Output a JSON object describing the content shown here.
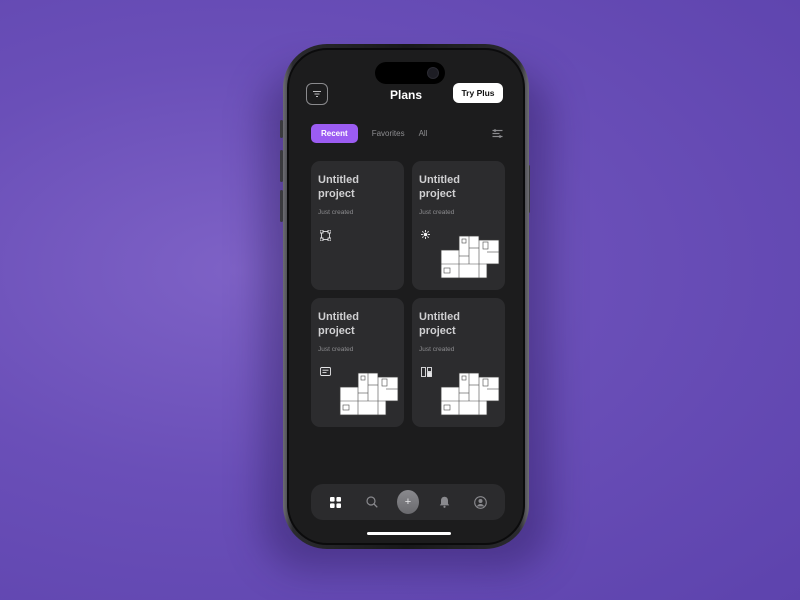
{
  "header": {
    "title": "Plans",
    "try_plus_label": "Try Plus"
  },
  "tabs": [
    {
      "label": "Recent",
      "active": true
    },
    {
      "label": "Favorites",
      "active": false
    },
    {
      "label": "All",
      "active": false
    }
  ],
  "projects": [
    {
      "title": "Untitled project",
      "status": "Just created",
      "icon": "selection-frame-icon",
      "has_preview": false
    },
    {
      "title": "Untitled project",
      "status": "Just created",
      "icon": "sparkle-icon",
      "has_preview": true
    },
    {
      "title": "Untitled project",
      "status": "Just created",
      "icon": "text-box-icon",
      "has_preview": true
    },
    {
      "title": "Untitled project",
      "status": "Just created",
      "icon": "layout-icon",
      "has_preview": true
    }
  ],
  "nav": [
    {
      "icon": "grid-icon",
      "active": true
    },
    {
      "icon": "search-icon",
      "active": false
    },
    {
      "icon": "add-icon",
      "label": "+",
      "active": false
    },
    {
      "icon": "bell-icon",
      "active": false
    },
    {
      "icon": "profile-icon",
      "active": false
    }
  ],
  "colors": {
    "accent": "#9b5cf2",
    "background": "#6a4fb8",
    "screen": "#1c1c1d",
    "card": "#2c2c2e"
  }
}
